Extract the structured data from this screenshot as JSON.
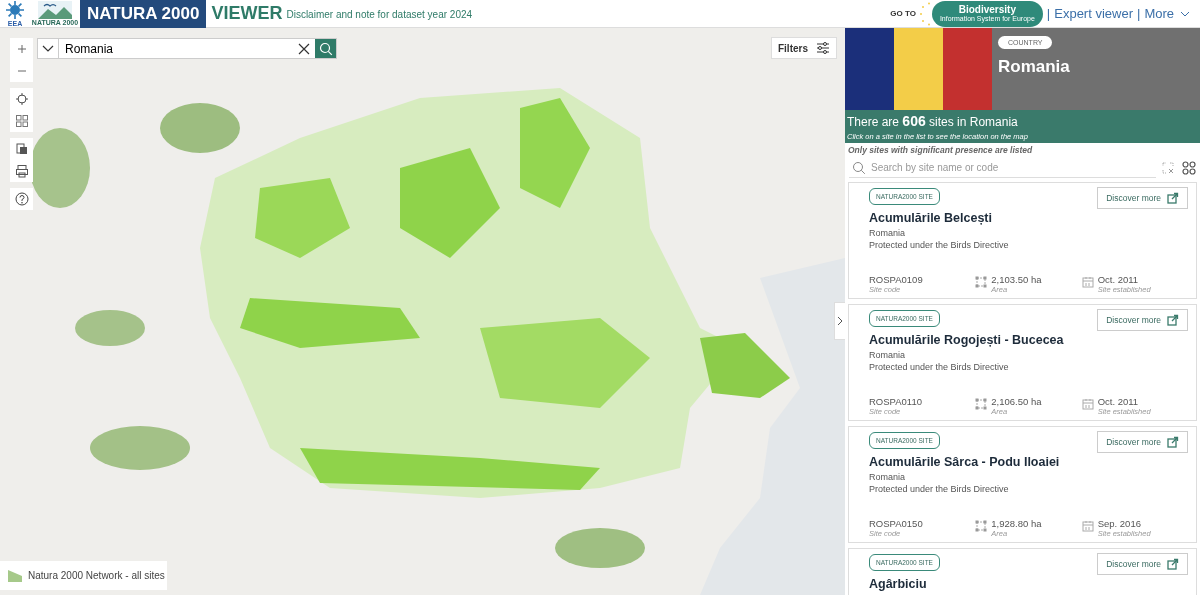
{
  "header": {
    "eea_logo": {
      "text": "EEA"
    },
    "natura_logo": {
      "text": "NATURA 2000"
    },
    "title": "NATURA 2000",
    "subtitle": "VIEWER",
    "disclaimer": "Disclaimer and note for dataset year 2024",
    "goto": "GO TO",
    "bise_logo": {
      "name": "Biodiversity",
      "tagline": "Information System for Europe"
    },
    "nav_items": [
      {
        "kind": "separator",
        "text": "|"
      },
      {
        "kind": "link",
        "text": "Expert viewer"
      },
      {
        "kind": "separator",
        "text": "|"
      },
      {
        "kind": "menu",
        "text": "More"
      }
    ]
  },
  "map": {
    "kind": "picture",
    "search": {
      "value": "Romania"
    },
    "filters_button": "Filters",
    "legend": {
      "label": "Natura 2000 Network - all sites"
    }
  },
  "panel": {
    "flag_stripes": [
      {
        "color": "#1b2f7a"
      },
      {
        "color": "#f3cd48"
      },
      {
        "color": "#c3302f"
      }
    ],
    "country_badge": "COUNTRY",
    "country_name": "Romania",
    "count_text": "There are **606** sites in Romania",
    "hint": "Click on a site in the list to see the location on the map",
    "note": "Only sites with significant presence are listed",
    "search": {
      "placeholder": "Search by site name or code"
    },
    "sites": [
      {
        "badge": "NATURA2000 SITE",
        "button": "Discover more",
        "name": "Acumulările Belcești",
        "country": "Romania",
        "protection": "Protected under the Birds Directive",
        "code": "ROSPA0109",
        "code_label": "Site code",
        "area": "2,103.50 ha",
        "area_label": "Area",
        "established": "Oct. 2011",
        "established_label": "Site established"
      },
      {
        "badge": "NATURA2000 SITE",
        "button": "Discover more",
        "name": "Acumulările Rogojești - Bucecea",
        "country": "Romania",
        "protection": "Protected under the Birds Directive",
        "code": "ROSPA0110",
        "code_label": "Site code",
        "area": "2,106.50 ha",
        "area_label": "Area",
        "established": "Oct. 2011",
        "established_label": "Site established"
      },
      {
        "badge": "NATURA2000 SITE",
        "button": "Discover more",
        "name": "Acumulările Sârca - Podu Iloaiei",
        "country": "Romania",
        "protection": "Protected under the Birds Directive",
        "code": "ROSPA0150",
        "code_label": "Site code",
        "area": "1,928.80 ha",
        "area_label": "Area",
        "established": "Sep. 2016",
        "established_label": "Site established"
      },
      {
        "badge": "NATURA2000 SITE",
        "button": "Discover more",
        "name": "Agârbiciu"
      }
    ]
  }
}
